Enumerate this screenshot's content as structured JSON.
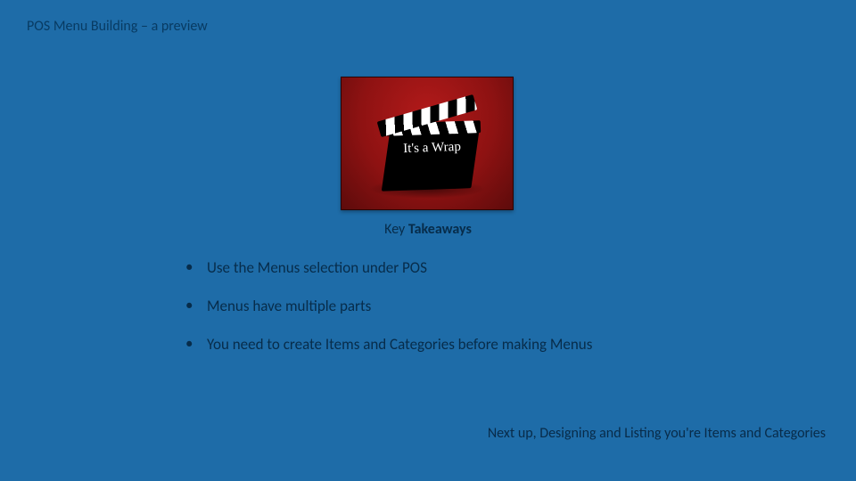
{
  "title": "POS Menu Building – a preview",
  "hero_text": "It's a Wrap",
  "subheading_prefix": "Key",
  "subheading_main": "Takeaways",
  "bullets": [
    "Use the Menus selection under POS",
    "Menus have multiple parts",
    "You need to create Items and Categories before making Menus"
  ],
  "footer": "Next up, Designing and Listing you're Items and Categories"
}
